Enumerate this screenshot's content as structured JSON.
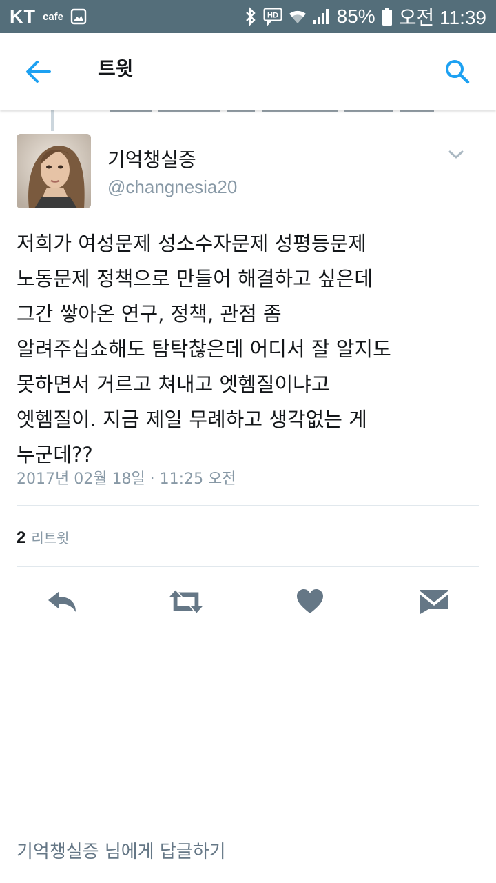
{
  "status_bar": {
    "carrier": "KT",
    "cafe_label": "cafe",
    "hd_label": "HD",
    "battery": "85%",
    "time": "오전 11:39"
  },
  "app_bar": {
    "title": "트윗",
    "back_icon": "arrow-back-icon",
    "search_icon": "search-icon"
  },
  "tweet": {
    "display_name": "기억챙실증",
    "handle": "@changnesia20",
    "text_lines": [
      "저희가 여성문제 성소수자문제 성평등문제",
      "노동문제 정책으로 만들어 해결하고 싶은데",
      "그간 쌓아온 연구, 정책, 관점 좀",
      "알려주십쇼해도 탐탁찮은데 어디서 잘 알지도",
      "못하면서 거르고 쳐내고 엣헴질이냐고",
      "엣헴질이. 지금 제일 무례하고  생각없는 게",
      "누군데??"
    ],
    "timestamp": "2017년 02월 18일 · 11:25 오전",
    "retweet_count": "2",
    "retweet_label": "리트윗"
  },
  "actions": {
    "reply_icon": "reply-icon",
    "retweet_icon": "retweet-icon",
    "like_icon": "heart-icon",
    "dm_icon": "envelope-icon"
  },
  "reply_bar": {
    "placeholder": "기억챙실증 님에게 답글하기"
  },
  "colors": {
    "status_bar": "#546e7a",
    "accent": "#1da1f2",
    "icon_gray": "#657786",
    "secondary_text": "#8899a6"
  }
}
